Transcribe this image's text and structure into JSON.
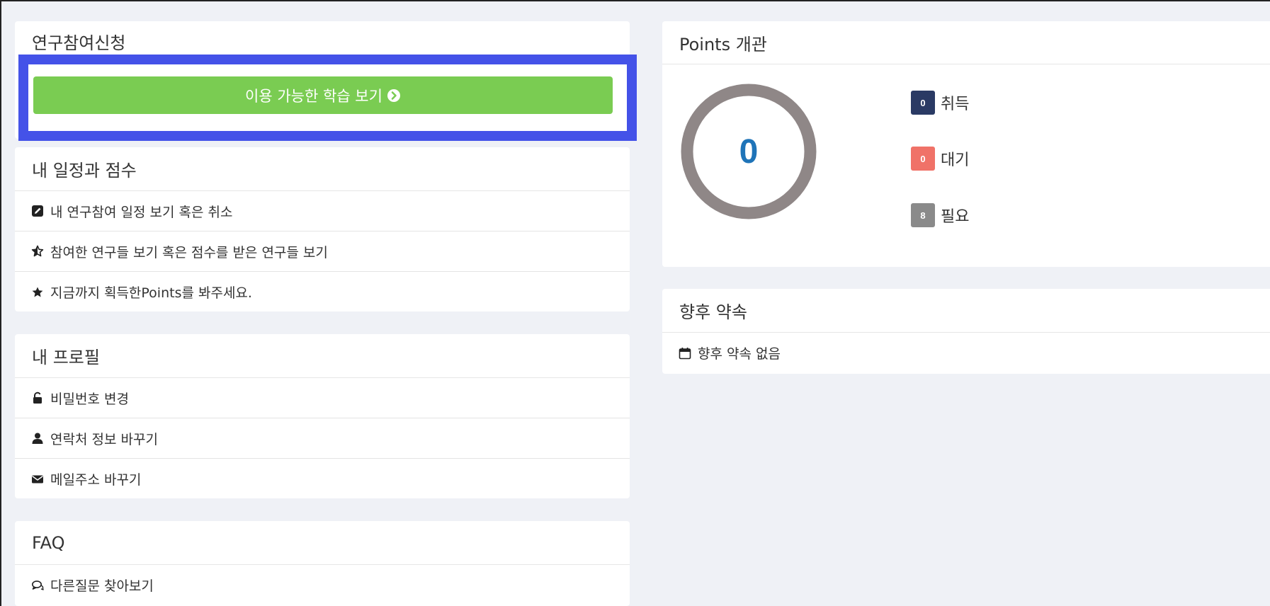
{
  "research_signup": {
    "title": "연구참여신청",
    "button_label": "이용 가능한 학습 보기"
  },
  "schedule": {
    "title": "내 일정과 점수",
    "items": [
      {
        "icon": "edit-icon",
        "label": "내 연구참여 일정 보기 혹은 취소"
      },
      {
        "icon": "star-half-icon",
        "label": "참여한 연구들 보기 혹은 점수를 받은 연구들 보기"
      },
      {
        "icon": "star-icon",
        "label": "지금까지 획득한Points를 봐주세요."
      }
    ]
  },
  "profile": {
    "title": "내 프로필",
    "items": [
      {
        "icon": "unlock-icon",
        "label": "비밀번호 변경"
      },
      {
        "icon": "user-icon",
        "label": "연락처 정보 바꾸기"
      },
      {
        "icon": "envelope-icon",
        "label": "메일주소 바꾸기"
      }
    ]
  },
  "faq": {
    "title": "FAQ",
    "items": [
      {
        "icon": "comments-icon",
        "label": "다른질문 찾아보기"
      }
    ]
  },
  "points": {
    "title": "Points 개관",
    "total": "0",
    "legend": [
      {
        "count": "0",
        "label": "취득",
        "color": "#2a3a64"
      },
      {
        "count": "0",
        "label": "대기",
        "color": "#f07268"
      },
      {
        "count": "8",
        "label": "필요",
        "color": "#8a8a8a"
      }
    ],
    "donut_color": "#8f8787"
  },
  "appointments": {
    "title": "향후 약속",
    "empty_label": "향후 약속 없음"
  },
  "colors": {
    "accent_button": "#7acc52",
    "highlight_border": "#4452e8",
    "page_bg": "#eff1f6"
  }
}
